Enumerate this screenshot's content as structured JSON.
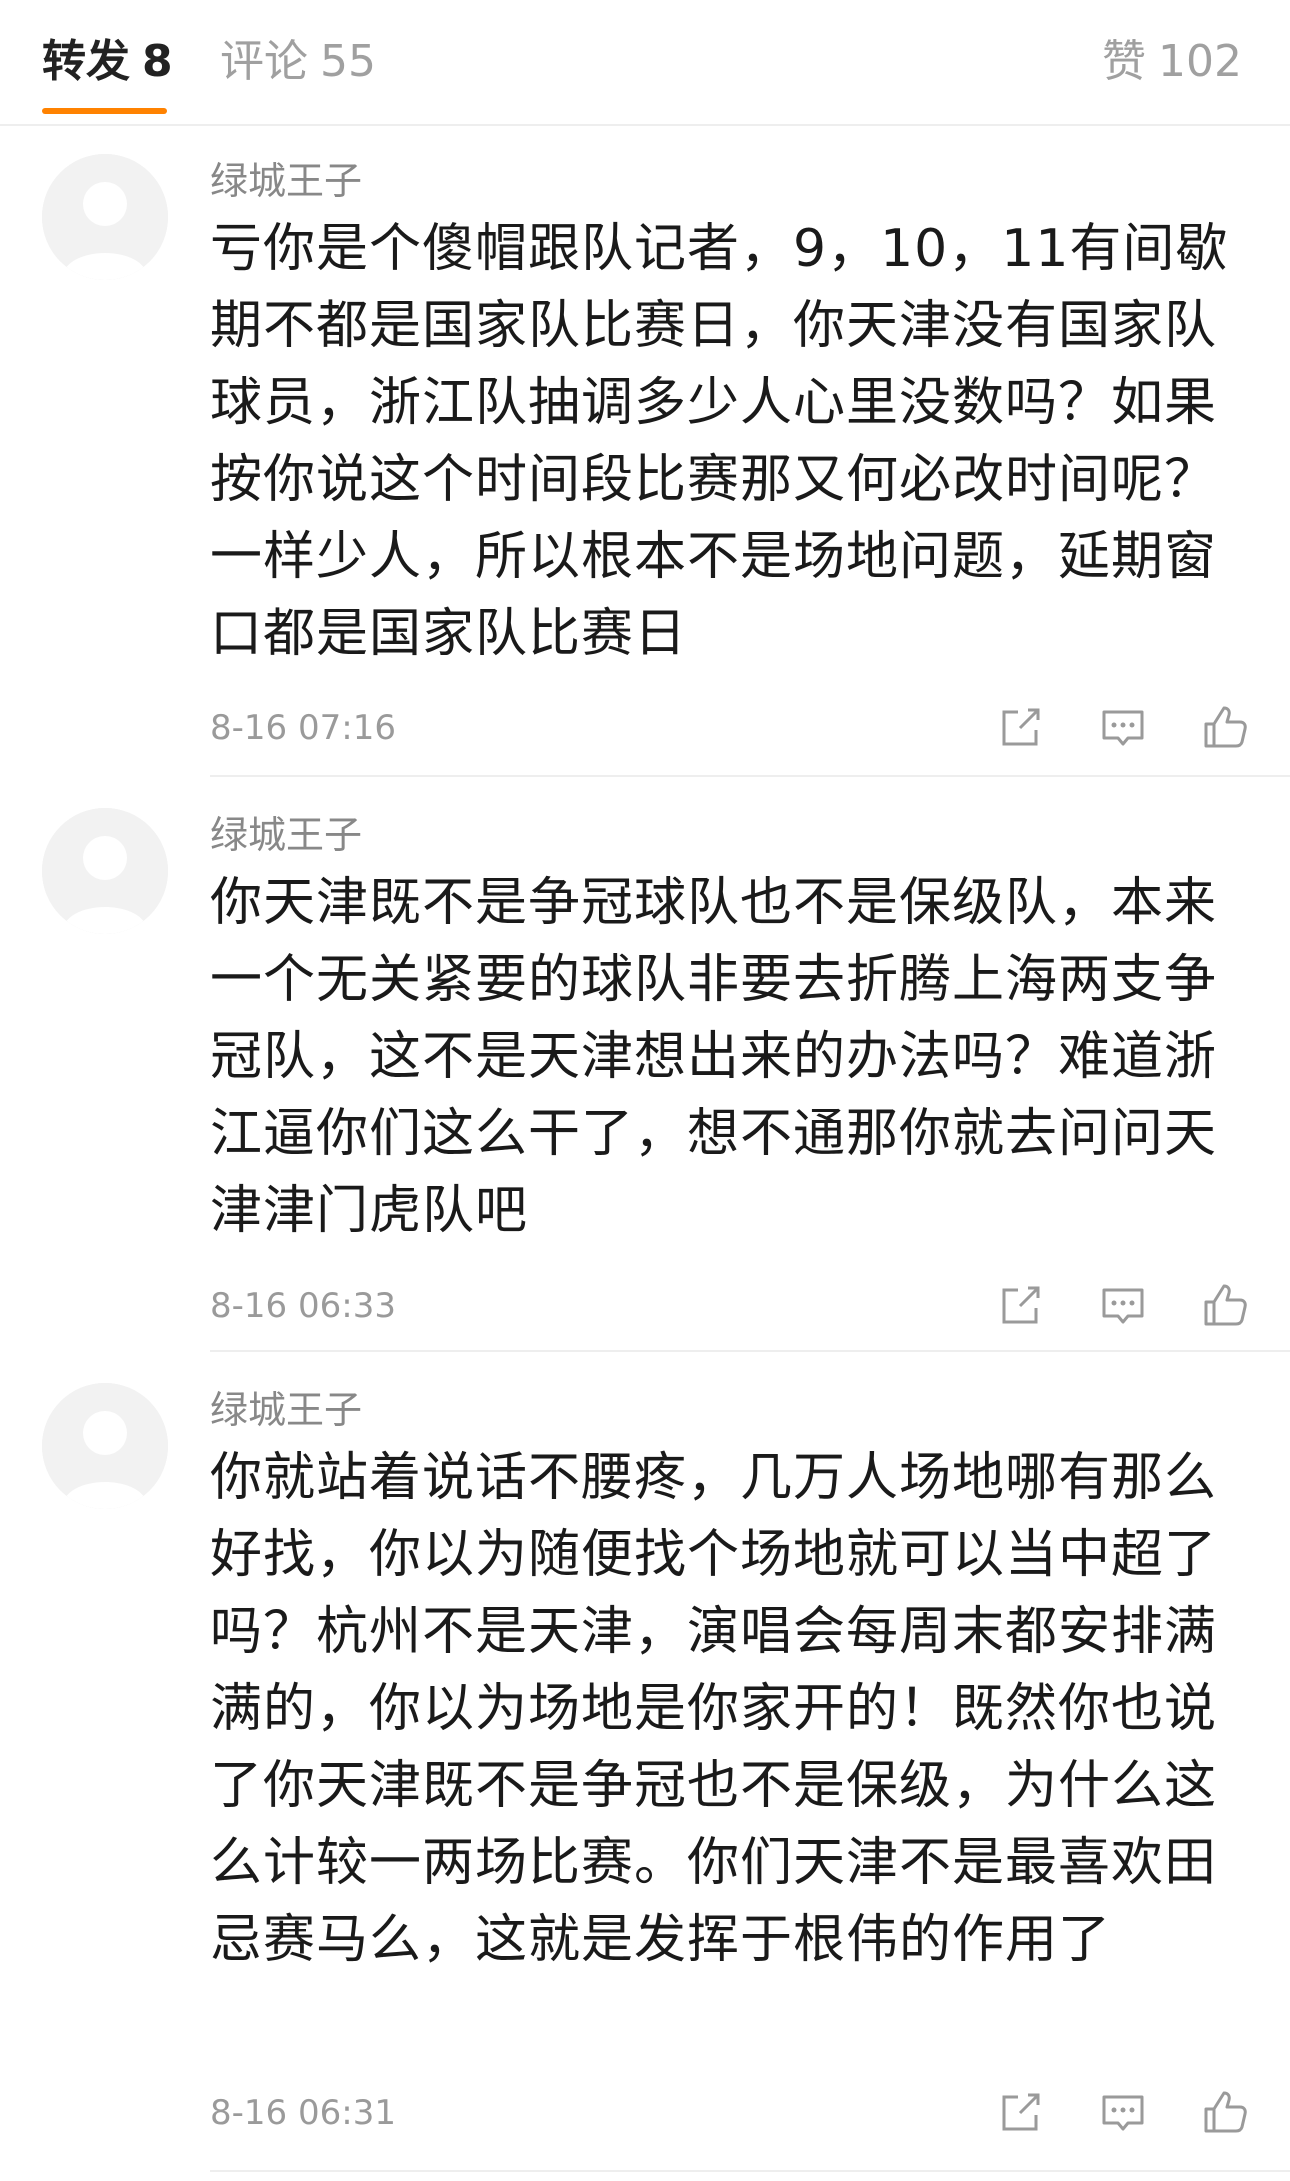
{
  "tabs": {
    "repost": {
      "label": "转发",
      "count": "8"
    },
    "comments": {
      "label": "评论",
      "count": "55"
    },
    "likes": {
      "label": "赞",
      "count": "102"
    }
  },
  "colors": {
    "accent": "#ff8200",
    "muted": "#9a9a9a"
  },
  "comments": [
    {
      "username": "绿城王子",
      "text": "亏你是个傻帽跟队记者，9，10，11有间歇期不都是国家队比赛日，你天津没有国家队球员，浙江队抽调多少人心里没数吗？如果按你说这个时间段比赛那又何必改时间呢？一样少人，所以根本不是场地问题，延期窗口都是国家队比赛日",
      "time": "8-16 07:16"
    },
    {
      "username": "绿城王子",
      "text": "你天津既不是争冠球队也不是保级队，本来一个无关紧要的球队非要去折腾上海两支争冠队，这不是天津想出来的办法吗？难道浙江逼你们这么干了，想不通那你就去问问天津津门虎队吧",
      "time": "8-16 06:33"
    },
    {
      "username": "绿城王子",
      "text": "你就站着说话不腰疼，几万人场地哪有那么好找，你以为随便找个场地就可以当中超了吗？杭州不是天津，演唱会每周末都安排满满的，你以为场地是你家开的！既然你也说了你天津既不是争冠也不是保级，为什么这么计较一两场比赛。你们天津不是最喜欢田忌赛马么，这就是发挥于根伟的作用了",
      "time": "8-16 06:31"
    }
  ],
  "icons": [
    "repost-icon",
    "reply-icon",
    "like-icon"
  ]
}
